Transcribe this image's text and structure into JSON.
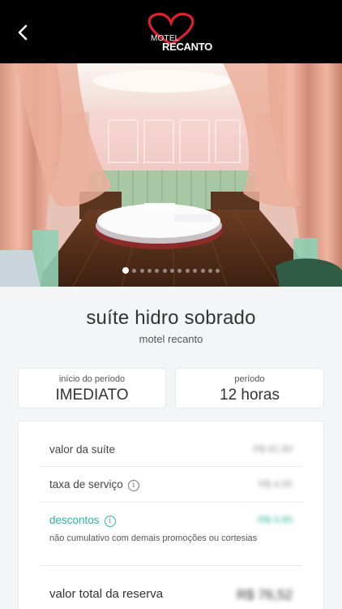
{
  "header": {
    "back_icon": "chevron-left-icon",
    "logo_line1": "MOTEL",
    "logo_line2": "RECANTO",
    "logo_heart_color": "#e0202a"
  },
  "gallery": {
    "photo_count": 13,
    "active_index": 0
  },
  "suite": {
    "name": "suíte hidro sobrado",
    "motel": "motel recanto"
  },
  "booking": {
    "start_label": "início do período",
    "start_value": "IMEDIATO",
    "period_label": "período",
    "period_value": "12 horas"
  },
  "pricing": {
    "suite_label": "valor da suíte",
    "suite_value": "R$ 82,90",
    "service_label": "taxa de serviço",
    "service_value": "R$ 4,90",
    "discount_label": "descontos",
    "discount_value": "-R$ 4,90",
    "discount_note": "não cumulativo com demais promoções ou cortesias",
    "total_label": "valor total da reserva",
    "total_value": "R$ 76,52"
  },
  "colors": {
    "header_bg": "#000000",
    "accent_teal": "#2bb59b",
    "page_bg": "#f4f5f6"
  }
}
